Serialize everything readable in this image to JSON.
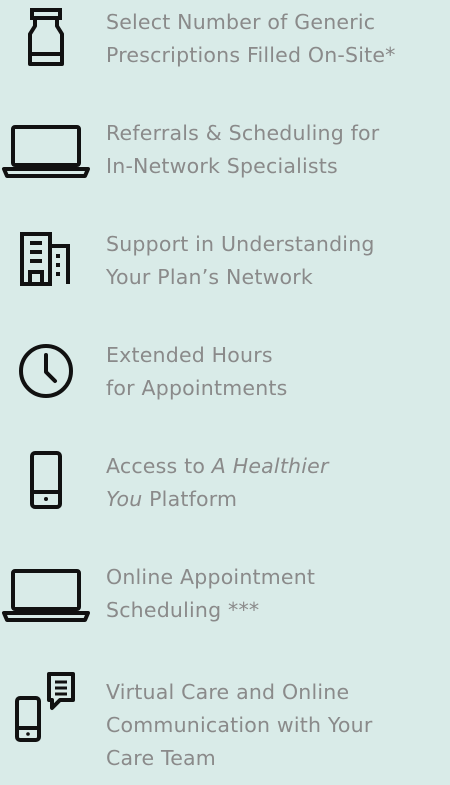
{
  "items": [
    {
      "icon": "medicine-bottle-icon",
      "line1": "Select Number of Generic",
      "line2": "Prescriptions Filled On-Site*"
    },
    {
      "icon": "laptop-icon",
      "line1": "Referrals & Scheduling for",
      "line2": "In-Network Specialists"
    },
    {
      "icon": "building-icon",
      "line1": "Support in Understanding",
      "line2": "Your Plan’s Network"
    },
    {
      "icon": "clock-icon",
      "line1": "Extended Hours",
      "line2": "for Appointments"
    },
    {
      "icon": "smartphone-icon",
      "line1_prefix": "Access to ",
      "line1_italic": "A Healthier",
      "line2_italic": "You",
      "line2_suffix": " Platform"
    },
    {
      "icon": "laptop-icon",
      "line1": "Online Appointment",
      "line2": "Scheduling ***"
    },
    {
      "icon": "phone-chat-icon",
      "line1": "Virtual Care and Online",
      "line2": "Communication with Your",
      "line3": "Care Team"
    }
  ]
}
